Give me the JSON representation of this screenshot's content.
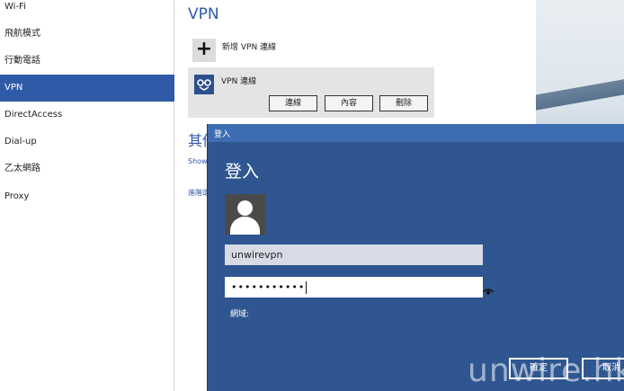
{
  "sidebar": {
    "items": [
      {
        "label": "Wi-Fi",
        "active": false
      },
      {
        "label": "飛航模式",
        "active": false
      },
      {
        "label": "行動電話",
        "active": false
      },
      {
        "label": "VPN",
        "active": true
      },
      {
        "label": "DirectAccess",
        "active": false
      },
      {
        "label": "Dial-up",
        "active": false
      },
      {
        "label": "乙太網路",
        "active": false
      },
      {
        "label": "Proxy",
        "active": false
      }
    ]
  },
  "main": {
    "title": "VPN",
    "add_vpn_label": "新增 VPN 連線",
    "connection": {
      "name": "VPN 連線",
      "connect_label": "連線",
      "properties_label": "內容",
      "delete_label": "刪除"
    },
    "other_heading": "其他",
    "show_link": "Show",
    "advanced_link": "進階選"
  },
  "dialog": {
    "title": "登入",
    "heading": "登入",
    "username_value": "unwirevpn",
    "password_mask": "•••••••••••",
    "domain_label": "網域:",
    "ok_label": "確定",
    "cancel_label": "取消"
  },
  "watermark": "unwire.hk",
  "colors": {
    "accent": "#2e5aa8",
    "dialog_bg": "#2f5690",
    "titlebar": "#3e6cb0"
  }
}
